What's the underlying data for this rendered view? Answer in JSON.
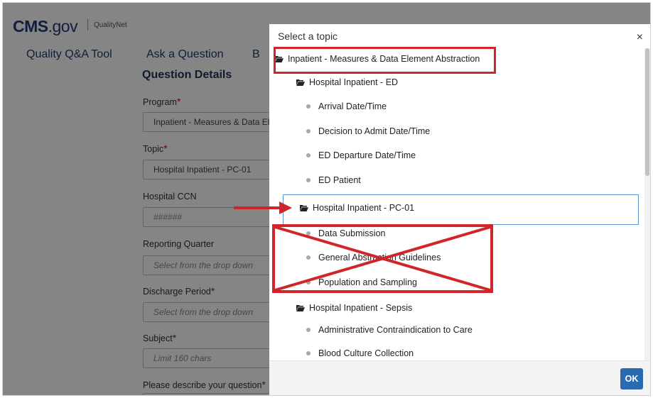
{
  "header": {
    "logo_main": "CMS",
    "logo_suffix": ".gov",
    "logo_sub": "QualityNet"
  },
  "nav": {
    "items": [
      "Quality Q&A Tool",
      "Ask a Question",
      "B"
    ]
  },
  "form": {
    "section_title": "Question Details",
    "program_label": "Program",
    "program_value": "Inpatient - Measures & Data Element Abstraction",
    "topic_label": "Topic",
    "topic_value": "Hospital Inpatient - PC-01",
    "ccn_label": "Hospital CCN",
    "ccn_placeholder": "######",
    "quarter_label": "Reporting Quarter",
    "quarter_placeholder": "Select from the drop down",
    "discharge_label": "Discharge Period",
    "discharge_placeholder": "Select from the drop down",
    "subject_label": "Subject",
    "subject_placeholder": "Limit 160 chars",
    "describe_label": "Please describe your question",
    "required_mark": "*"
  },
  "modal": {
    "title": "Select a topic",
    "close": "×",
    "ok": "OK",
    "tree": [
      {
        "label": "Inpatient - Measures & Data Element Abstraction",
        "type": "folder",
        "level": 0
      },
      {
        "label": "Hospital Inpatient - ED",
        "type": "folder",
        "level": 1
      },
      {
        "label": "Arrival Date/Time",
        "type": "leaf",
        "level": 2
      },
      {
        "label": "Decision to Admit Date/Time",
        "type": "leaf",
        "level": 2
      },
      {
        "label": "ED Departure Date/Time",
        "type": "leaf",
        "level": 2
      },
      {
        "label": "ED Patient",
        "type": "leaf",
        "level": 2
      },
      {
        "label": "Hospital Inpatient - PC-01",
        "type": "folder",
        "level": 1,
        "selected": true
      },
      {
        "label": "Data Submission",
        "type": "leaf",
        "level": 2
      },
      {
        "label": "General Abstraction Guidelines",
        "type": "leaf",
        "level": 2
      },
      {
        "label": "Population and Sampling",
        "type": "leaf",
        "level": 2
      },
      {
        "label": "Hospital Inpatient - Sepsis",
        "type": "folder",
        "level": 1
      },
      {
        "label": "Administrative Contraindication to Care",
        "type": "leaf",
        "level": 2
      },
      {
        "label": "Blood Culture Collection",
        "type": "leaf",
        "level": 2
      }
    ]
  },
  "colors": {
    "annotation_red": "#d0262b",
    "brand_blue": "#1f3d7a",
    "ok_button": "#2a6bb0"
  }
}
